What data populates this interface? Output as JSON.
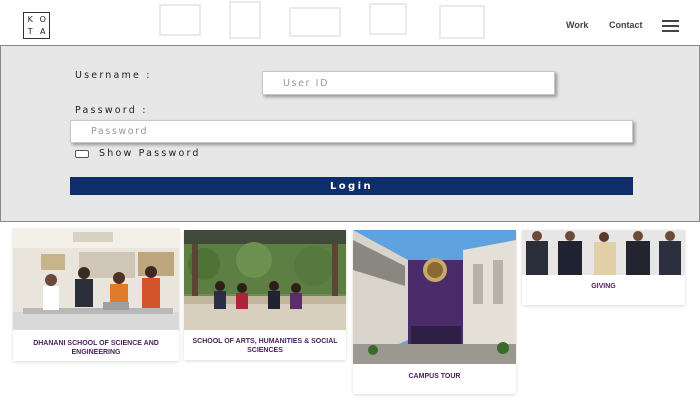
{
  "header": {
    "logo_letters": [
      "K",
      "O",
      "T",
      "A"
    ],
    "nav": {
      "work": "Work",
      "contact": "Contact"
    },
    "menu_icon": "hamburger-menu-icon"
  },
  "login": {
    "username_label": "Username :",
    "username_placeholder": "User ID",
    "password_label": "Password :",
    "password_placeholder": "Password",
    "show_password_label": "Show Password",
    "show_password_checked": false,
    "login_button": "Login"
  },
  "cards": [
    {
      "caption": "DHANANI SCHOOL OF SCIENCE AND ENGINEERING"
    },
    {
      "caption": "SCHOOL OF ARTS, HUMANITIES & SOCIAL SCIENCES"
    },
    {
      "caption": "CAMPUS TOUR"
    },
    {
      "caption": "GIVING"
    }
  ],
  "colors": {
    "login_button": "#0d2e6b",
    "panel_background": "#e7e7e7",
    "caption_text": "#4a1d5c"
  }
}
